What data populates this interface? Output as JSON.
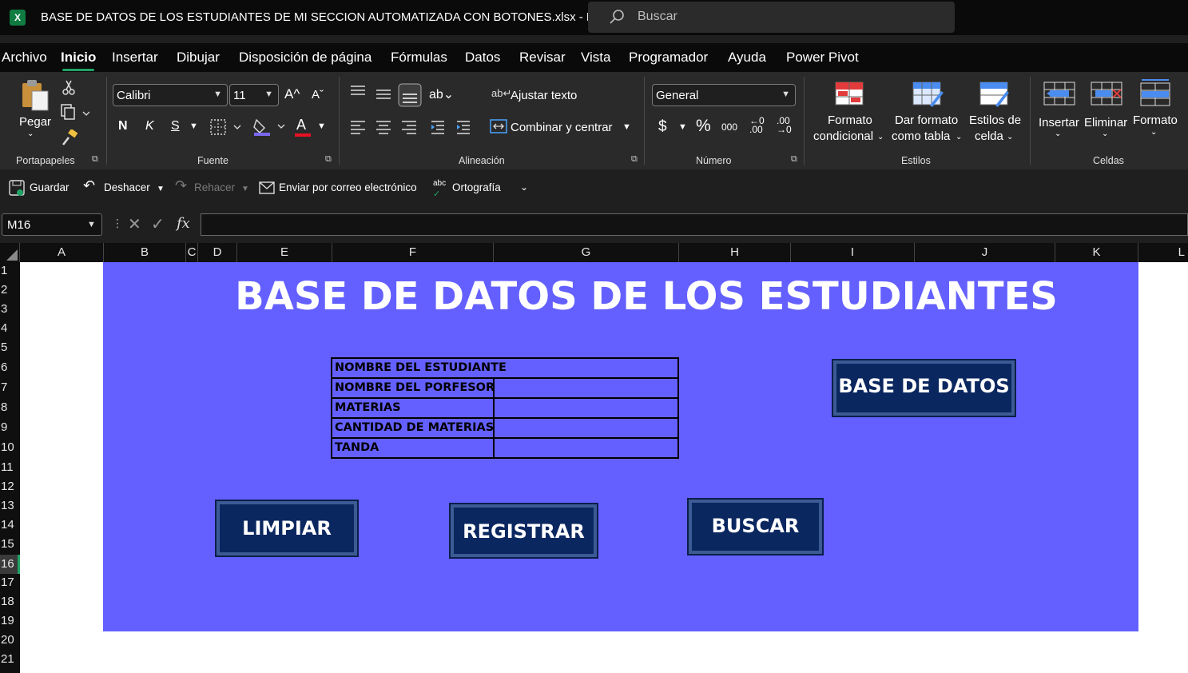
{
  "titlebar": {
    "app_icon": "X",
    "title": "BASE DE DATOS DE LOS ESTUDIANTES DE MI SECCION AUTOMATIZADA CON BOTONES.xlsx  -  E...",
    "search_placeholder": "Buscar"
  },
  "menu": {
    "items": [
      "Archivo",
      "Inicio",
      "Insertar",
      "Dibujar",
      "Disposición de página",
      "Fórmulas",
      "Datos",
      "Revisar",
      "Vista",
      "Programador",
      "Ayuda",
      "Power Pivot"
    ],
    "active": "Inicio"
  },
  "ribbon": {
    "portapapeles": {
      "paste": "Pegar",
      "label": "Portapapeles"
    },
    "fuente": {
      "font": "Calibri",
      "size": "11",
      "bold": "N",
      "italic": "K",
      "underline": "S",
      "label": "Fuente",
      "fill_color": "#7b68ee",
      "font_color": "#e81123"
    },
    "alineacion": {
      "wrap": "Ajustar texto",
      "merge": "Combinar y centrar",
      "label": "Alineación"
    },
    "numero": {
      "format": "General",
      "currency": "$",
      "percent": "%",
      "thousands": "000",
      "label": "Número"
    },
    "estilos": {
      "cond_1": "Formato",
      "cond_2": "condicional",
      "table_1": "Dar formato",
      "table_2": "como tabla",
      "cell_1": "Estilos de",
      "cell_2": "celda",
      "label": "Estilos"
    },
    "celdas": {
      "insert": "Insertar",
      "delete": "Eliminar",
      "format": "Formato",
      "label": "Celdas"
    }
  },
  "qat": {
    "save": "Guardar",
    "undo": "Deshacer",
    "redo": "Rehacer",
    "email": "Enviar por correo electrónico",
    "spelling": "Ortografía",
    "spelling_abc": "abc"
  },
  "formula_bar": {
    "name_box": "M16",
    "fx": "fx",
    "value": ""
  },
  "columns": [
    "A",
    "B",
    "C",
    "D",
    "E",
    "F",
    "G",
    "H",
    "I",
    "J",
    "K",
    "L"
  ],
  "rows": [
    "1",
    "2",
    "3",
    "4",
    "5",
    "6",
    "7",
    "8",
    "9",
    "10",
    "11",
    "12",
    "13",
    "14",
    "15",
    "16",
    "17",
    "18",
    "19",
    "20",
    "21"
  ],
  "sheet": {
    "title": "BASE DE DATOS DE LOS ESTUDIANTES",
    "panel_color": "#6460ff",
    "form_labels": [
      "NOMBRE DEL ESTUDIANTE",
      "NOMBRE DEL PORFESOR",
      "MATERIAS",
      "CANTIDAD DE MATERIAS",
      "TANDA"
    ],
    "buttons": {
      "database": "BASE DE DATOS",
      "clear": "LIMPIAR",
      "register": "REGISTRAR",
      "search": "BUSCAR"
    }
  }
}
